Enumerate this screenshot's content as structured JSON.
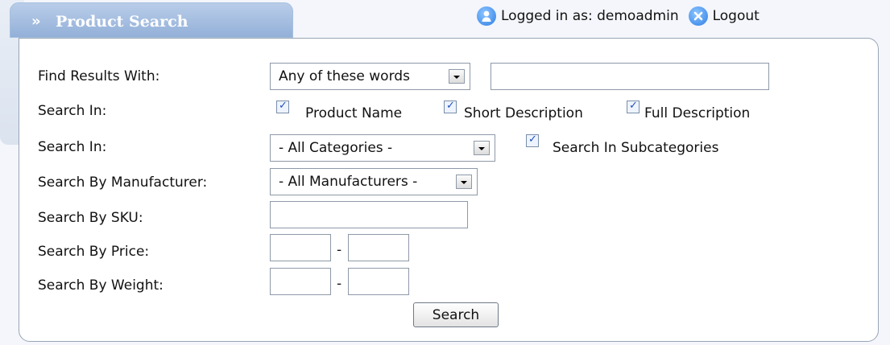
{
  "tab": {
    "chevron": "»",
    "title": "Product Search"
  },
  "user": {
    "logged_in_text": "Logged in as: demoadmin",
    "logout_label": "Logout"
  },
  "form": {
    "find_results_label": "Find Results With:",
    "find_mode_selected": "Any of these words",
    "keywords_value": "",
    "search_in_label": "Search In:",
    "product_name_label": "Product Name",
    "product_name_checked": true,
    "short_description_label": "Short Description",
    "short_description_checked": true,
    "full_description_label": "Full Description",
    "full_description_checked": true,
    "search_in_category_label": "Search In:",
    "category_selected": "- All Categories -",
    "subcategories_label": "Search In Subcategories",
    "subcategories_checked": true,
    "manufacturer_label": "Search By Manufacturer:",
    "manufacturer_selected": "- All Manufacturers -",
    "sku_label": "Search By SKU:",
    "sku_value": "",
    "price_label": "Search By Price:",
    "price_from": "",
    "price_to": "",
    "weight_label": "Search By Weight:",
    "weight_from": "",
    "weight_to": "",
    "range_separator": "-",
    "search_button_label": "Search"
  }
}
